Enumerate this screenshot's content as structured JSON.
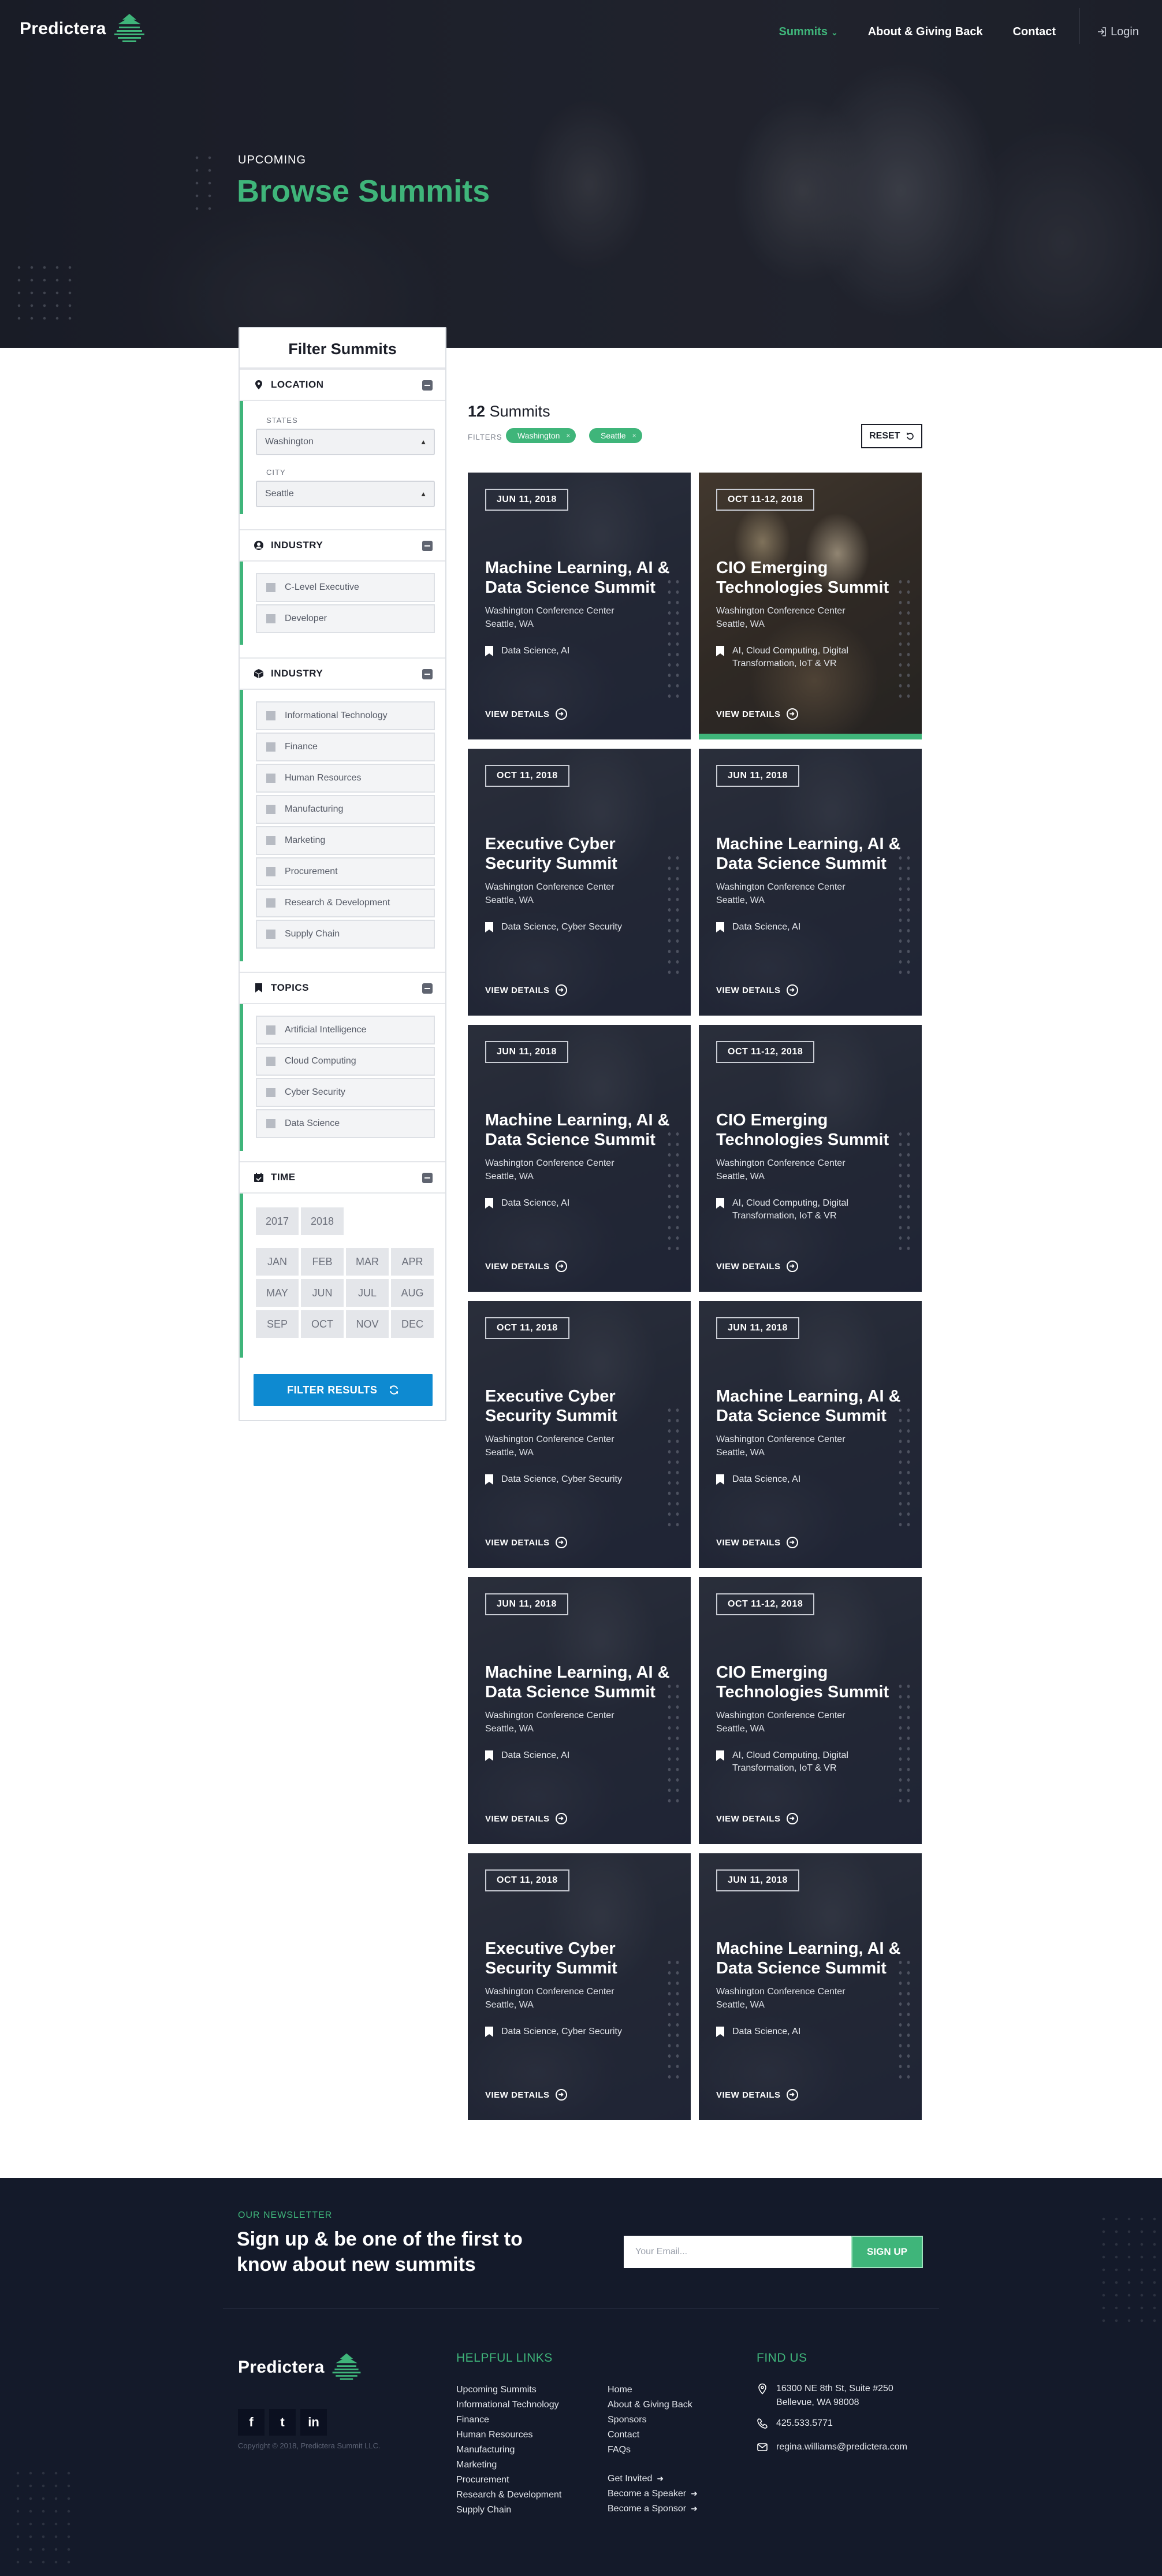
{
  "header": {
    "logo": "Predictera",
    "nav": [
      {
        "label": "Summits",
        "active": true,
        "caret": "⌄"
      },
      {
        "label": "About & Giving Back",
        "active": false
      },
      {
        "label": "Contact",
        "active": false
      }
    ],
    "login": "Login"
  },
  "hero": {
    "eyebrow": "UPCOMING",
    "title": "Browse Summits"
  },
  "sidebar": {
    "title": "Filter Summits",
    "location": {
      "label": "LOCATION",
      "states_label": "STATES",
      "state_value": "Washington",
      "city_label": "CITY",
      "city_value": "Seattle"
    },
    "industry_roles": {
      "label": "INDUSTRY",
      "items": [
        "C-Level Executive",
        "Developer"
      ]
    },
    "industry": {
      "label": "INDUSTRY",
      "items": [
        "Informational Technology",
        "Finance",
        "Human Resources",
        "Manufacturing",
        "Marketing",
        "Procurement",
        "Research & Development",
        "Supply Chain"
      ]
    },
    "topics": {
      "label": "TOPICS",
      "items": [
        "Artificial Intelligence",
        "Cloud Computing",
        "Cyber Security",
        "Data Science"
      ]
    },
    "time": {
      "label": "TIME",
      "years": [
        "2017",
        "2018"
      ],
      "months": [
        "JAN",
        "FEB",
        "MAR",
        "APR",
        "MAY",
        "JUN",
        "JUL",
        "AUG",
        "SEP",
        "OCT",
        "NOV",
        "DEC"
      ]
    },
    "filter_button": "FILTER RESULTS"
  },
  "results": {
    "count": "12",
    "count_label": "Summits",
    "filters_label": "FILTERS",
    "chips": [
      "Washington",
      "Seattle"
    ],
    "chip_remove": "×",
    "reset": "RESET"
  },
  "cards": [
    {
      "date": "JUN 11, 2018",
      "title": "Machine Learning, AI & Data Science Summit",
      "venue": "Washington Conference Center",
      "city": "Seattle, WA",
      "tags": "Data Science, AI",
      "cta": "VIEW DETAILS"
    },
    {
      "date": "OCT 11-12, 2018",
      "title": "CIO Emerging Technologies Summit",
      "venue": "Washington Conference Center",
      "city": "Seattle, WA",
      "tags": "AI, Cloud Computing, Digital Transformation, IoT & VR",
      "cta": "VIEW DETAILS"
    },
    {
      "date": "OCT 11, 2018",
      "title": "Executive Cyber Security Summit",
      "venue": "Washington Conference Center",
      "city": "Seattle, WA",
      "tags": "Data Science, Cyber Security",
      "cta": "VIEW DETAILS"
    },
    {
      "date": "JUN 11, 2018",
      "title": "Machine Learning, AI & Data Science Summit",
      "venue": "Washington Conference Center",
      "city": "Seattle, WA",
      "tags": "Data Science, AI",
      "cta": "VIEW DETAILS"
    },
    {
      "date": "JUN 11, 2018",
      "title": "Machine Learning, AI & Data Science Summit",
      "venue": "Washington Conference Center",
      "city": "Seattle, WA",
      "tags": "Data Science, AI",
      "cta": "VIEW DETAILS"
    },
    {
      "date": "OCT 11-12, 2018",
      "title": "CIO Emerging Technologies Summit",
      "venue": "Washington Conference Center",
      "city": "Seattle, WA",
      "tags": "AI, Cloud Computing, Digital Transformation, IoT & VR",
      "cta": "VIEW DETAILS"
    },
    {
      "date": "OCT 11, 2018",
      "title": "Executive Cyber Security Summit",
      "venue": "Washington Conference Center",
      "city": "Seattle, WA",
      "tags": "Data Science, Cyber Security",
      "cta": "VIEW DETAILS"
    },
    {
      "date": "JUN 11, 2018",
      "title": "Machine Learning, AI & Data Science Summit",
      "venue": "Washington Conference Center",
      "city": "Seattle, WA",
      "tags": "Data Science, AI",
      "cta": "VIEW DETAILS"
    },
    {
      "date": "JUN 11, 2018",
      "title": "Machine Learning, AI & Data Science Summit",
      "venue": "Washington Conference Center",
      "city": "Seattle, WA",
      "tags": "Data Science, AI",
      "cta": "VIEW DETAILS"
    },
    {
      "date": "OCT 11-12, 2018",
      "title": "CIO Emerging Technologies Summit",
      "venue": "Washington Conference Center",
      "city": "Seattle, WA",
      "tags": "AI, Cloud Computing, Digital Transformation, IoT & VR",
      "cta": "VIEW DETAILS"
    },
    {
      "date": "OCT 11, 2018",
      "title": "Executive Cyber Security Summit",
      "venue": "Washington Conference Center",
      "city": "Seattle, WA",
      "tags": "Data Science, Cyber Security",
      "cta": "VIEW DETAILS"
    },
    {
      "date": "JUN 11, 2018",
      "title": "Machine Learning, AI & Data Science Summit",
      "venue": "Washington Conference Center",
      "city": "Seattle, WA",
      "tags": "Data Science, AI",
      "cta": "VIEW DETAILS"
    }
  ],
  "newsletter": {
    "eyebrow": "OUR NEWSLETTER",
    "title": "Sign up & be one of the first to know about new summits",
    "placeholder": "Your Email...",
    "button": "SIGN UP"
  },
  "footer": {
    "logo": "Predictera",
    "social": [
      "f",
      "t",
      "in"
    ],
    "copyright": "Copyright © 2018, Predictera Summit LLC.",
    "helpful_title": "HELPFUL LINKS",
    "col1": [
      "Upcoming Summits",
      "Informational Technology",
      "Finance",
      "Human Resources",
      "Manufacturing",
      "Marketing",
      "Procurement",
      "Research & Development",
      "Supply Chain"
    ],
    "col2": [
      "Home",
      "About & Giving Back",
      "Sponsors",
      "Contact",
      "FAQs"
    ],
    "col2_cta": [
      "Get Invited",
      "Become a Speaker",
      "Become a Sponsor"
    ],
    "find_title": "FIND US",
    "address_line1": "16300 NE 8th St, Suite #250",
    "address_line2": "Bellevue, WA 98008",
    "phone": "425.533.5771",
    "email": "regina.williams@predictera.com"
  },
  "colors": {
    "accent": "#3fb57a",
    "button_blue": "#0e8ad1",
    "dark": "#141a2a"
  },
  "icons": [
    "logo-stack-icon",
    "login-icon",
    "pin-icon",
    "user-circle-icon",
    "cube-icon",
    "bookmark-icon",
    "calendar-check-icon",
    "minus-icon",
    "refresh-icon",
    "undo-icon",
    "arrow-circle-right-icon",
    "facebook-icon",
    "twitter-icon",
    "linkedin-icon",
    "phone-icon",
    "mail-icon"
  ]
}
